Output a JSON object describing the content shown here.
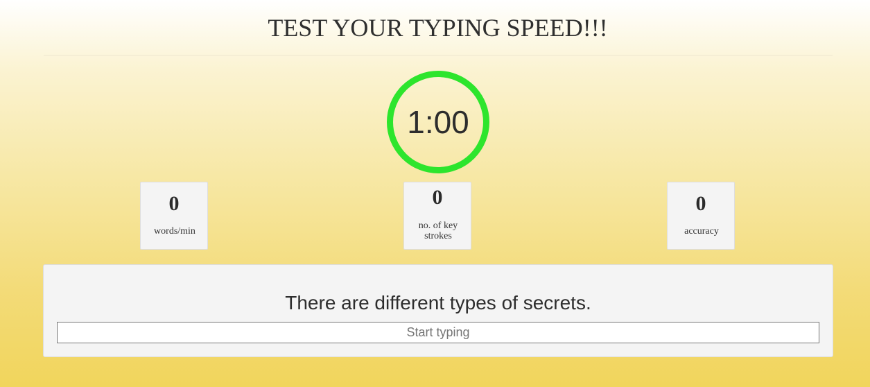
{
  "header": {
    "title": "TEST YOUR TYPING SPEED!!!"
  },
  "timer": {
    "display": "1:00",
    "ring_color": "#2de52d"
  },
  "stats": {
    "wpm": {
      "value": "0",
      "label": "words/min"
    },
    "keystrokes": {
      "value": "0",
      "label": "no. of key strokes"
    },
    "accuracy": {
      "value": "0",
      "label": "accuracy"
    }
  },
  "typing": {
    "sentence": "There are different types of secrets.",
    "input_value": "",
    "input_placeholder": "Start typing"
  }
}
